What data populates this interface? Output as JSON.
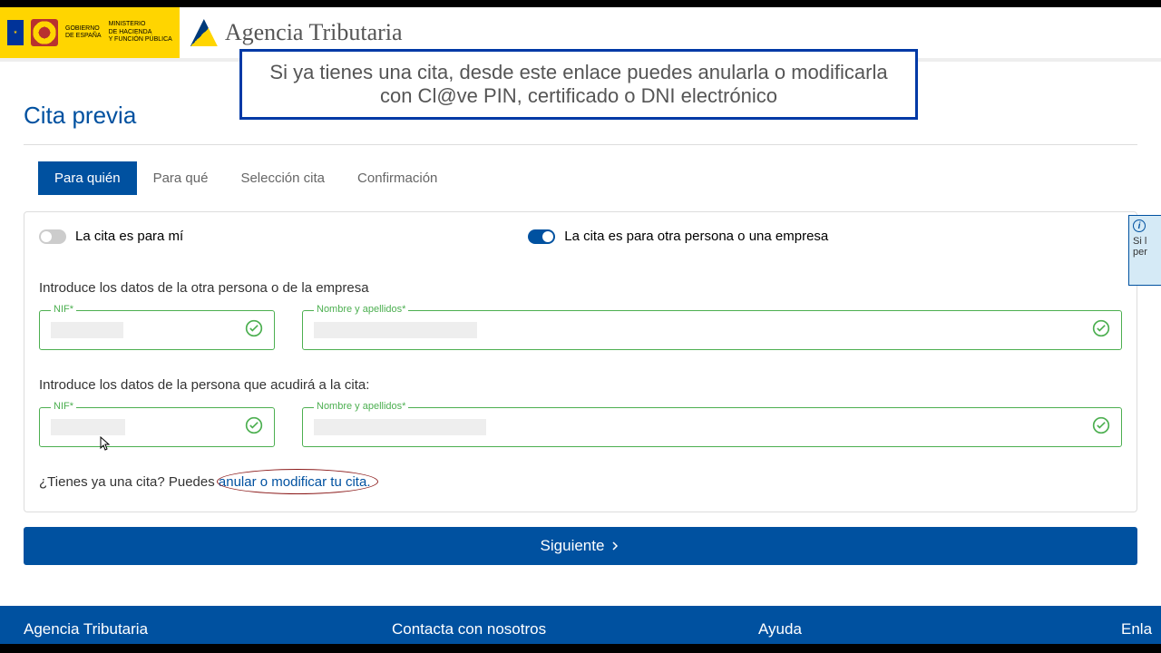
{
  "gov": {
    "line1": "GOBIERNO",
    "line2": "DE ESPAÑA",
    "min1": "MINISTERIO",
    "min2": "DE HACIENDA",
    "min3": "Y FUNCIÓN PÚBLICA"
  },
  "agency": "Agencia Tributaria",
  "callout": "Si ya tienes una cita, desde este enlace puedes anularla o modificarla con Cl@ve PIN, certificado o DNI electrónico",
  "pageTitle": "Cita previa",
  "tabs": [
    "Para quién",
    "Para qué",
    "Selección cita",
    "Confirmación"
  ],
  "toggles": {
    "me": "La cita es para mí",
    "other": "La cita es para otra persona o una empresa"
  },
  "section1": "Introduce los datos de la otra persona o de la empresa",
  "section2": "Introduce los datos de la persona que acudirá a la cita:",
  "fields": {
    "nif": "NIF*",
    "name": "Nombre y apellidos*"
  },
  "question": {
    "prefix": "¿Tienes ya una cita? Puedes ",
    "link": "anular o modificar tu cita."
  },
  "nextButton": "Siguiente",
  "footer": {
    "c1": "Agencia Tributaria",
    "c2": "Contacta con nosotros",
    "c3": "Ayuda",
    "c4": "Enla"
  },
  "sideTip": {
    "l1": "Si l",
    "l2": "per"
  }
}
